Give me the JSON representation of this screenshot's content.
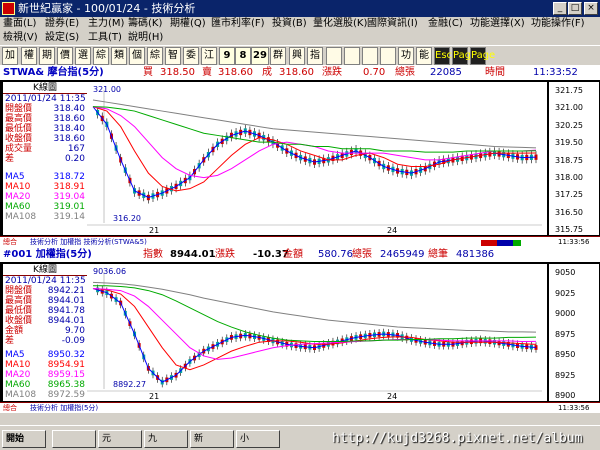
{
  "window": {
    "title": "新世紀贏家 - 100/01/24 - 技術分析"
  },
  "menu": {
    "row1": [
      "畫面(L)",
      "證券(E)",
      "主力(M)",
      "籌碼(K)",
      "期權(Q)",
      "匯市利率(F)",
      "投資(B)",
      "量化選股(K)",
      "國際資訊(I)",
      "金融(C)",
      "功能選擇(X)",
      "功能操作(F)"
    ],
    "row2": [
      "檢視(V)",
      "設定(S)",
      "工具(T)",
      "說明(H)"
    ]
  },
  "toolbar": {
    "buttons": [
      "加",
      "權",
      "期",
      "價",
      "選",
      "綜",
      "類",
      "個",
      "綜",
      "智",
      "委",
      "江",
      "9",
      "8",
      "29",
      "群",
      "興",
      "指",
      "",
      "",
      "",
      "",
      "功",
      "能",
      "Esc",
      "Page",
      "Page"
    ]
  },
  "top": {
    "symbol": "STWA& 摩台指(5分)",
    "buy_label": "買",
    "buy": "318.50",
    "sell_label": "賣",
    "sell": "318.60",
    "deal_label": "成",
    "deal": "318.60",
    "chg_label": "漲跌",
    "chg": "0.70",
    "vol_label": "總張",
    "vol": "22085",
    "time_label": "時間",
    "time": "11:33:52",
    "k_title": "K線圖",
    "datetime": "2011/01/24 11:35",
    "rows": [
      {
        "k": "開盤價",
        "v": "318.40"
      },
      {
        "k": "最高價",
        "v": "318.60"
      },
      {
        "k": "最低價",
        "v": "318.40"
      },
      {
        "k": "收盤價",
        "v": "318.60"
      },
      {
        "k": "成交量",
        "v": "167"
      },
      {
        "k": "差",
        "v": "0.20"
      }
    ],
    "ma": [
      {
        "k": "MA5",
        "v": "318.72",
        "color": "#0000ff"
      },
      {
        "k": "MA10",
        "v": "318.91",
        "color": "#ff0000"
      },
      {
        "k": "MA20",
        "v": "319.04",
        "color": "#ff00ff"
      },
      {
        "k": "MA60",
        "v": "319.01",
        "color": "#00aa00"
      },
      {
        "k": "MA108",
        "v": "319.14",
        "color": "#808080"
      }
    ],
    "high_label": "321.00",
    "low_label": "316.20",
    "day_labels": [
      "21",
      "24"
    ],
    "yticks": [
      "321.75",
      "321.00",
      "320.25",
      "319.50",
      "318.75",
      "318.00",
      "317.25",
      "316.50",
      "315.75"
    ],
    "status_left": "總合",
    "status_text": "技術分析 加權指 技術分析(STWA&5)",
    "status_right": "11:33:56"
  },
  "bottom": {
    "symbol": "#001 加權指(5分)",
    "idx_label": "指數",
    "idx": "8944.01",
    "chg_label": "漲跌",
    "chg": "-10.37",
    "amt_label": "金額",
    "amt": "580.76",
    "vol_label": "總張",
    "vol": "2465949",
    "cnt_label": "總筆",
    "cnt": "481386",
    "k_title": "K線圖",
    "datetime": "2011/01/24 11:35",
    "rows": [
      {
        "k": "開盤價",
        "v": "8942.21"
      },
      {
        "k": "最高價",
        "v": "8944.01"
      },
      {
        "k": "最低價",
        "v": "8941.78"
      },
      {
        "k": "收盤價",
        "v": "8944.01"
      },
      {
        "k": "金額",
        "v": "9.70"
      },
      {
        "k": "差",
        "v": "-0.09"
      }
    ],
    "ma": [
      {
        "k": "MA5",
        "v": "8950.32",
        "color": "#0000ff"
      },
      {
        "k": "MA10",
        "v": "8954.91",
        "color": "#ff0000"
      },
      {
        "k": "MA20",
        "v": "8959.15",
        "color": "#ff00ff"
      },
      {
        "k": "MA60",
        "v": "8965.38",
        "color": "#00aa00"
      },
      {
        "k": "MA108",
        "v": "8972.59",
        "color": "#808080"
      }
    ],
    "high_label": "9036.06",
    "low_label": "8892.27",
    "day_labels": [
      "21",
      "24"
    ],
    "yticks": [
      "9050",
      "9025",
      "9000",
      "8975",
      "8950",
      "8925",
      "8900"
    ],
    "status_left": "總合",
    "status_text": "技術分析 加權指(5分)",
    "status_right": "11:33:56"
  },
  "taskbar": {
    "start": "開始",
    "tasks": [
      "",
      "元",
      "九",
      "新",
      "小"
    ]
  },
  "watermark": "http://kujd3268.pixnet.net/album",
  "chart_data": [
    {
      "type": "line",
      "title": "STWA& 摩台指(5分)",
      "ylim": [
        315.75,
        321.75
      ],
      "x": [
        "21",
        "24"
      ],
      "series": [
        {
          "name": "MA5",
          "color": "#0000ff",
          "values": [
            321.0,
            320.2,
            318.6,
            317.2,
            316.9,
            317.1,
            317.4,
            317.8,
            318.6,
            319.3,
            319.7,
            319.9,
            319.7,
            319.4,
            319.0,
            318.7,
            318.5,
            318.6,
            318.8,
            319.0,
            318.7,
            318.3,
            318.1,
            318.0,
            318.2,
            318.5,
            318.6,
            318.7,
            318.8,
            318.9,
            318.8,
            318.7,
            318.72
          ]
        },
        {
          "name": "MA10",
          "color": "#ff0000",
          "values": [
            321.0,
            320.8,
            320.1,
            319.0,
            318.0,
            317.4,
            317.2,
            317.3,
            317.6,
            318.2,
            318.8,
            319.3,
            319.6,
            319.5,
            319.3,
            319.0,
            318.8,
            318.6,
            318.6,
            318.8,
            318.9,
            318.7,
            318.4,
            318.3,
            318.3,
            318.4,
            318.6,
            318.7,
            318.8,
            318.9,
            318.9,
            318.9,
            318.91
          ]
        },
        {
          "name": "MA20",
          "color": "#ff00ff",
          "values": [
            321.0,
            320.9,
            320.6,
            320.1,
            319.4,
            318.7,
            318.2,
            317.9,
            317.8,
            317.9,
            318.2,
            318.6,
            319.0,
            319.3,
            319.4,
            319.3,
            319.2,
            319.0,
            318.9,
            318.9,
            318.9,
            318.9,
            318.8,
            318.7,
            318.6,
            318.6,
            318.7,
            318.8,
            318.9,
            319.0,
            319.0,
            319.0,
            319.04
          ]
        },
        {
          "name": "MA60",
          "color": "#00aa00",
          "values": [
            321.0,
            320.98,
            320.9,
            320.8,
            320.6,
            320.4,
            320.2,
            320.0,
            319.8,
            319.7,
            319.6,
            319.5,
            319.4,
            319.4,
            319.3,
            319.3,
            319.2,
            319.2,
            319.1,
            319.1,
            319.1,
            319.0,
            319.0,
            319.0,
            318.95,
            318.95,
            318.95,
            319.0,
            319.0,
            319.0,
            319.0,
            319.0,
            319.01
          ]
        },
        {
          "name": "MA108",
          "color": "#808080",
          "values": [
            321.3,
            321.2,
            321.1,
            321.0,
            320.9,
            320.8,
            320.7,
            320.6,
            320.5,
            320.4,
            320.3,
            320.2,
            320.1,
            320.0,
            319.95,
            319.9,
            319.85,
            319.8,
            319.75,
            319.7,
            319.65,
            319.6,
            319.55,
            319.5,
            319.45,
            319.4,
            319.35,
            319.3,
            319.25,
            319.2,
            319.18,
            319.16,
            319.14
          ]
        }
      ]
    },
    {
      "type": "line",
      "title": "#001 加權指(5分)",
      "ylim": [
        8890,
        9060
      ],
      "x": [
        "21",
        "24"
      ],
      "series": [
        {
          "name": "MA5",
          "color": "#0000ff",
          "values": [
            9036,
            9030,
            9015,
            8970,
            8920,
            8900,
            8910,
            8930,
            8945,
            8955,
            8965,
            8968,
            8965,
            8960,
            8955,
            8952,
            8950,
            8955,
            8960,
            8965,
            8968,
            8970,
            8968,
            8962,
            8958,
            8955,
            8955,
            8958,
            8960,
            8958,
            8955,
            8952,
            8950.32
          ]
        },
        {
          "name": "MA10",
          "color": "#ff0000",
          "values": [
            9036,
            9034,
            9028,
            9010,
            8980,
            8950,
            8925,
            8918,
            8925,
            8935,
            8945,
            8952,
            8958,
            8960,
            8960,
            8958,
            8955,
            8955,
            8957,
            8960,
            8963,
            8965,
            8966,
            8965,
            8962,
            8960,
            8958,
            8958,
            8958,
            8958,
            8957,
            8956,
            8954.91
          ]
        },
        {
          "name": "MA20",
          "color": "#ff00ff",
          "values": [
            9036,
            9035,
            9033,
            9025,
            9010,
            8990,
            8970,
            8950,
            8938,
            8933,
            8935,
            8940,
            8945,
            8950,
            8953,
            8955,
            8956,
            8957,
            8958,
            8959,
            8960,
            8961,
            8962,
            8962,
            8962,
            8961,
            8960,
            8960,
            8960,
            8960,
            8960,
            8959,
            8959.15
          ]
        },
        {
          "name": "MA60",
          "color": "#00aa00",
          "values": [
            9040,
            9040,
            9039,
            9037,
            9033,
            9027,
            9018,
            9008,
            8998,
            8988,
            8980,
            8973,
            8968,
            8964,
            8961,
            8960,
            8959,
            8959,
            8959,
            8960,
            8960,
            8961,
            8961,
            8962,
            8962,
            8963,
            8963,
            8964,
            8964,
            8964,
            8965,
            8965,
            8965.38
          ]
        },
        {
          "name": "MA108",
          "color": "#808080",
          "values": [
            9045,
            9044,
            9043,
            9041,
            9038,
            9035,
            9031,
            9027,
            9022,
            9018,
            9014,
            9010,
            9006,
            9002,
            8999,
            8996,
            8993,
            8990,
            8988,
            8986,
            8984,
            8982,
            8980,
            8979,
            8978,
            8977,
            8976,
            8975,
            8975,
            8974,
            8973,
            8973,
            8972.59
          ]
        }
      ]
    }
  ]
}
